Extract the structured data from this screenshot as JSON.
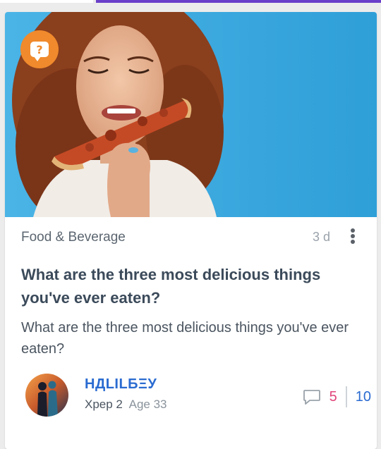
{
  "theme": {
    "accent_purple": "#6a3fc9",
    "badge_orange": "#f08a2c",
    "link_blue": "#2a6bd1",
    "comment_pink": "#e0457b",
    "sky_blue": "#3aa6dc"
  },
  "card": {
    "hero": {
      "image": "woman-eating-pizza-photo",
      "type_badge_icon": "question-bubble-icon",
      "type_badge_glyph": "?"
    },
    "category": "Food & Beverage",
    "posted_ago": "3 d",
    "more_icon": "more-vertical-icon",
    "title": "What are the three most delicious things you've ever eaten?",
    "body": "What are the three most delicious things you've ever eaten?",
    "author": {
      "avatar": "couple-silhouette-avatar",
      "name": "НДLILБΞУ",
      "xp_label": "Xpeр 2",
      "age_label": "Age 33"
    },
    "stats": {
      "comment_icon": "comment-bubble-icon",
      "comments": "5",
      "votes": "10"
    }
  }
}
